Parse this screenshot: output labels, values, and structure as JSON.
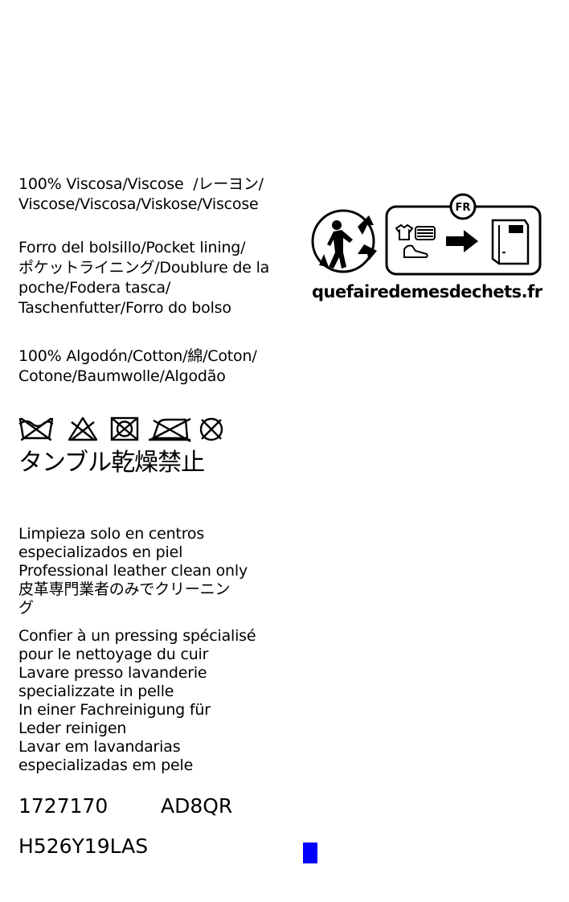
{
  "composition": {
    "main": "100% Viscosa/Viscose  /レーヨン/\nViscose/Viscosa/Viskose/Viscose",
    "lining_title": "Forro del bolsillo/Pocket lining/\nポケットライニング/Doublure de la\npoche/Fodera tasca/\nTaschenfutter/Forro do bolso",
    "lining": "100% Algodón/Cotton/綿/Coton/\nCotone/Baumwolle/Algodão"
  },
  "care_symbols": [
    "do-not-wash-icon",
    "do-not-bleach-icon",
    "do-not-tumble-dry-icon",
    "do-not-iron-icon",
    "do-not-dry-clean-icon"
  ],
  "tumble_note": "タンブル乾燥禁止",
  "care_text": "Limpieza solo en centros\nespecializados en piel\nProfessional leather clean only\n皮革専門業者のみでクリーニン\nグ",
  "care_text_2": "Confier à un pressing spécialisé\npour le nettoyage du cuir\nLavare presso lavanderie\nspecializzate in pelle\nIn einer Fachreinigung für\nLeder reinigen\nLavar em lavandarias\nespecializadas em pele",
  "codes": {
    "article": "1727170",
    "lot": "AD8QR",
    "reference": "H526Y19LAS"
  },
  "recycling": {
    "country": "FR",
    "website": "quefairedemesdechets.fr"
  },
  "colors": {
    "text": "#000000",
    "accent": "#0000ff"
  }
}
